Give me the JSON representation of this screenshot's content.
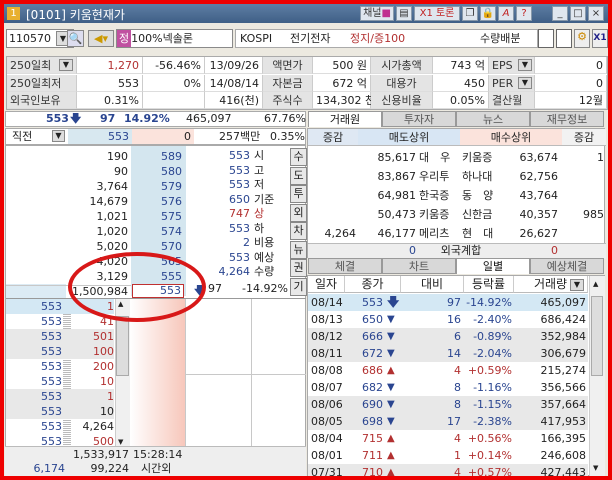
{
  "title": {
    "badge": "1",
    "text": "[0101] 키움현재가",
    "buttons": [
      "채널",
      "X1 토론"
    ],
    "icons": [
      "channel-icon",
      "layout-icon",
      "x1-icon",
      "window-icon",
      "lock-icon",
      "font-icon",
      "help-icon",
      "minimize-icon",
      "maximize-icon",
      "close-icon"
    ]
  },
  "toolbar": {
    "code": "110570",
    "flag": "정",
    "name": "100%넥솔론",
    "market": "KOSPI",
    "sector": "전기전자",
    "status": "정지/증100",
    "distribution": "수량배분"
  },
  "info": {
    "rows": [
      [
        "250일최",
        "1,270",
        "-56.46%",
        "13/09/26",
        "액면가",
        "500 원",
        "시가총액",
        "743 억",
        "EPS",
        "0"
      ],
      [
        "250일최저",
        "553",
        "0%",
        "14/08/14",
        "자본금",
        "672 억",
        "대용가",
        "450",
        "PER",
        "0"
      ],
      [
        "외국인보유",
        "0.31%",
        "",
        "416(천)",
        "주식수",
        "134,302 천",
        "신용비율",
        "0.05%",
        "결산월",
        "12월"
      ]
    ]
  },
  "summary": {
    "price": "553",
    "change": "97",
    "rate": "14.92%",
    "volume": "465,097",
    "vol_rate": "67.76%",
    "prev_label": "직전",
    "prev_price": "553",
    "prev_qty": "0",
    "amount": "257백만",
    "amount_rate": "0.35%"
  },
  "orderbook": [
    {
      "vol": "190",
      "price": "589"
    },
    {
      "vol": "90",
      "price": "580"
    },
    {
      "vol": "3,764",
      "price": "579"
    },
    {
      "vol": "14,679",
      "price": "576"
    },
    {
      "vol": "1,021",
      "price": "575"
    },
    {
      "vol": "1,020",
      "price": "574"
    },
    {
      "vol": "5,020",
      "price": "570"
    },
    {
      "vol": "4,020",
      "price": "565"
    },
    {
      "vol": "3,129",
      "price": "555"
    },
    {
      "vol": "1,500,984",
      "price": "553"
    }
  ],
  "stats": [
    {
      "v": "553",
      "l": "시"
    },
    {
      "v": "553",
      "l": "고"
    },
    {
      "v": "553",
      "l": "저"
    },
    {
      "v": "650",
      "l": "기준"
    },
    {
      "v": "747",
      "l": "상"
    },
    {
      "v": "553",
      "l": "하"
    },
    {
      "v": "2",
      "l": "비용"
    },
    {
      "v": "553",
      "l": "예상"
    },
    {
      "v": "4,264",
      "l": "수량"
    }
  ],
  "expected": {
    "change": "97",
    "rate": "-14.92%"
  },
  "side_buttons": [
    "수",
    "도",
    "투",
    "외",
    "차",
    "뉴",
    "권",
    "기"
  ],
  "ticks": [
    {
      "price": "553",
      "qty": "1",
      "up": true
    },
    {
      "price": "553",
      "qty": "41",
      "up": true
    },
    {
      "price": "553",
      "qty": "501",
      "up": true
    },
    {
      "price": "553",
      "qty": "100",
      "up": true
    },
    {
      "price": "553",
      "qty": "200",
      "up": true
    },
    {
      "price": "553",
      "qty": "10",
      "up": true
    },
    {
      "price": "553",
      "qty": "1",
      "up": true
    },
    {
      "price": "553",
      "qty": "10",
      "up": false
    },
    {
      "price": "553",
      "qty": "4,264",
      "up": false
    },
    {
      "price": "553",
      "qty": "500",
      "up": true
    }
  ],
  "footer": {
    "total": "1,533,917",
    "time": "15:28:14",
    "left": "6,174",
    "qty": "99,224",
    "session": "시간외"
  },
  "right_tabs": [
    "거래원",
    "투자자",
    "뉴스",
    "재무정보"
  ],
  "brokers": {
    "headers": [
      "증감",
      "매도상위",
      "매수상위",
      "증감"
    ],
    "rows": [
      {
        "sd": "",
        "sv": "85,617",
        "sn": "대　우",
        "bn": "키움증",
        "bv": "63,674",
        "bd": "1"
      },
      {
        "sd": "",
        "sv": "83,867",
        "sn": "우리투",
        "bn": "하나대",
        "bv": "62,756",
        "bd": ""
      },
      {
        "sd": "",
        "sv": "64,981",
        "sn": "한국증",
        "bn": "동　양",
        "bv": "43,764",
        "bd": ""
      },
      {
        "sd": "",
        "sv": "50,473",
        "sn": "키움증",
        "bn": "신한금",
        "bv": "40,357",
        "bd": "985"
      },
      {
        "sd": "4,264",
        "sv": "46,177",
        "sn": "메리츠",
        "bn": "현　대",
        "bv": "26,627",
        "bd": ""
      }
    ],
    "foreign": {
      "sell": "0",
      "label": "외국계합",
      "buy": "0"
    }
  },
  "bottom_tabs": [
    "체결",
    "차트",
    "일별",
    "예상체결"
  ],
  "daily": {
    "headers": [
      "일자",
      "종가",
      "대비",
      "등락률",
      "거래량"
    ],
    "rows": [
      {
        "date": "08/14",
        "close": "553",
        "dir": "down-arrow",
        "diff": "97",
        "rate": "-14.92%",
        "vol": "465,097"
      },
      {
        "date": "08/13",
        "close": "650",
        "dir": "down",
        "diff": "16",
        "rate": "-2.40%",
        "vol": "686,424"
      },
      {
        "date": "08/12",
        "close": "666",
        "dir": "down",
        "diff": "6",
        "rate": "-0.89%",
        "vol": "352,984"
      },
      {
        "date": "08/11",
        "close": "672",
        "dir": "down",
        "diff": "14",
        "rate": "-2.04%",
        "vol": "306,679"
      },
      {
        "date": "08/08",
        "close": "686",
        "dir": "up",
        "diff": "4",
        "rate": "+0.59%",
        "vol": "215,274"
      },
      {
        "date": "08/07",
        "close": "682",
        "dir": "down",
        "diff": "8",
        "rate": "-1.16%",
        "vol": "356,566"
      },
      {
        "date": "08/06",
        "close": "690",
        "dir": "down",
        "diff": "8",
        "rate": "-1.15%",
        "vol": "357,664"
      },
      {
        "date": "08/05",
        "close": "698",
        "dir": "down",
        "diff": "17",
        "rate": "-2.38%",
        "vol": "417,953"
      },
      {
        "date": "08/04",
        "close": "715",
        "dir": "up",
        "diff": "4",
        "rate": "+0.56%",
        "vol": "166,395"
      },
      {
        "date": "08/01",
        "close": "711",
        "dir": "up",
        "diff": "1",
        "rate": "+0.14%",
        "vol": "246,608"
      },
      {
        "date": "07/31",
        "close": "710",
        "dir": "up",
        "diff": "4",
        "rate": "+0.57%",
        "vol": "427,443"
      }
    ]
  },
  "colors": {
    "up": "#b23030",
    "down": "#2a4590",
    "annotation": "#d81818"
  }
}
